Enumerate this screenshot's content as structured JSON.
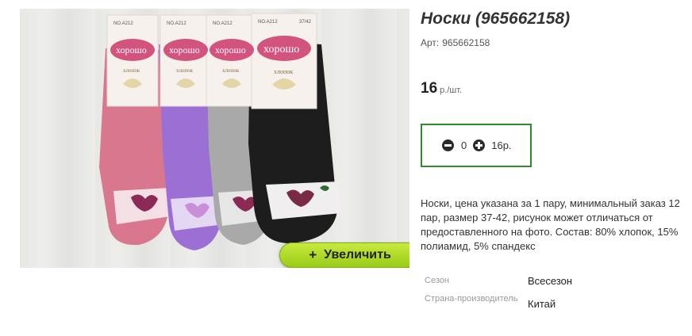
{
  "product": {
    "title": "Носки (965662158)",
    "sku_label": "Арт:",
    "sku_value": "965662158",
    "price_value": "16",
    "price_unit": "р./шт."
  },
  "cart": {
    "quantity": "0",
    "total": "16р."
  },
  "image": {
    "zoom_label": "Увеличить",
    "zoom_icon": "+",
    "tag_brand": "хорошо",
    "tag_sub": "хлопок",
    "tag_code": "NO.A212",
    "tag_size": "37/42",
    "sock_colors": [
      "#d9778f",
      "#9b6fd4",
      "#a9a9a9",
      "#1d1d1d"
    ],
    "accent_color": "#98cc17"
  },
  "description": "Носки, цена указана за 1 пару, минимальный заказ 12 пар, размер 37-42, рисунок может отличаться от предоставленного на фото. Состав: 80% хлопок, 15% полиамид, 5% спандекс",
  "properties": [
    {
      "key": "Сезон",
      "value": "Всесезон"
    },
    {
      "key": "Страна-производитель",
      "value": "Китай"
    }
  ]
}
